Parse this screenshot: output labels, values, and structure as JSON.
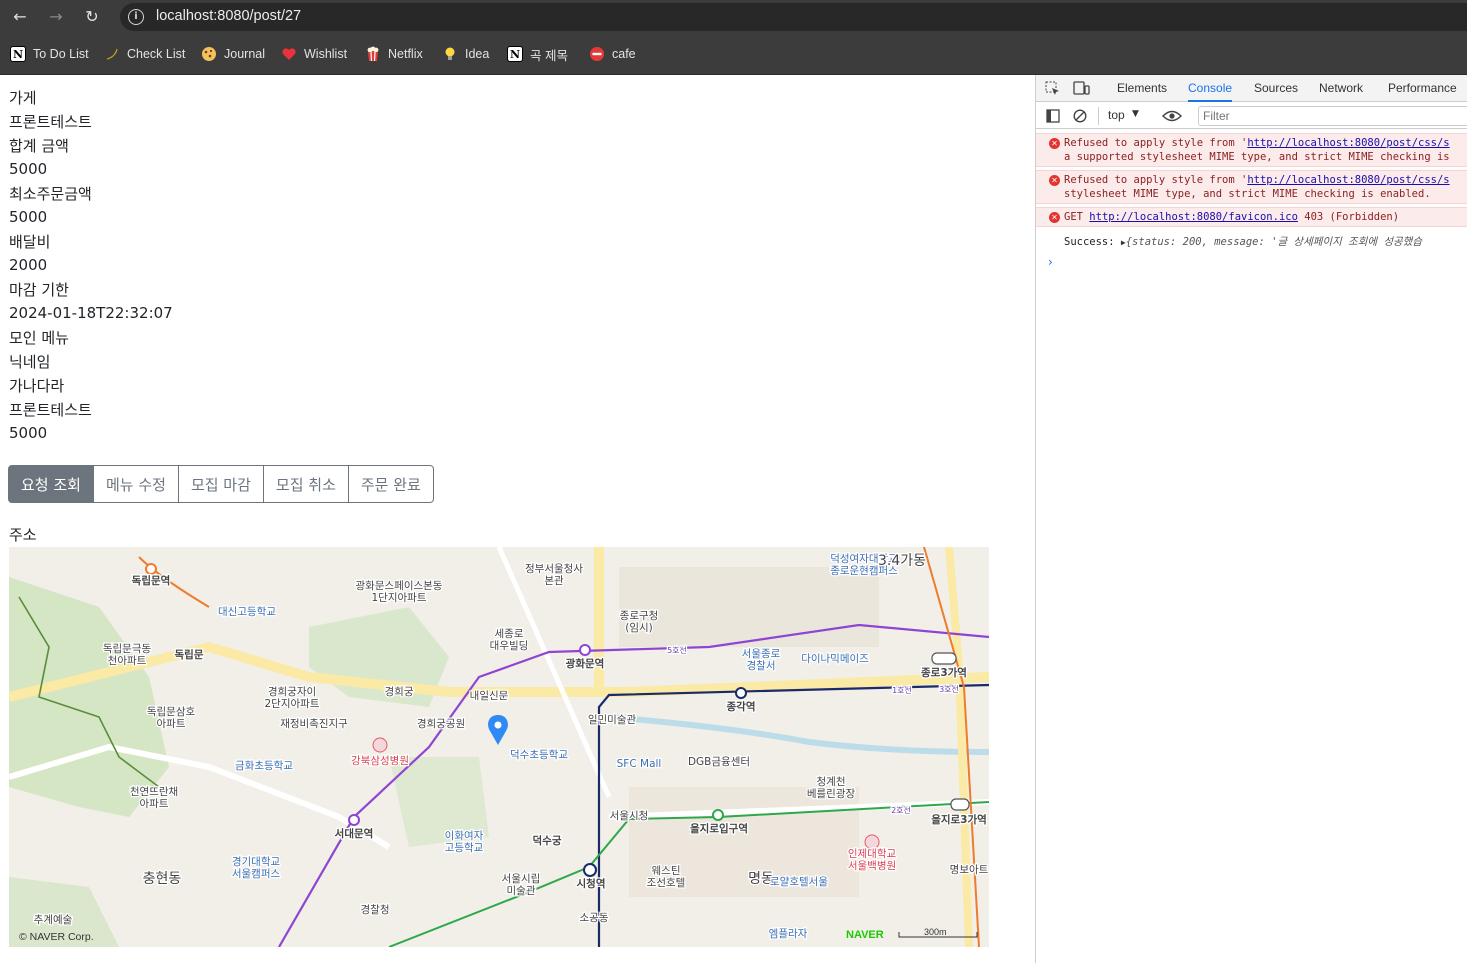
{
  "browser": {
    "url": "localhost:8080/post/27",
    "bookmarks": [
      {
        "label": "To Do List",
        "icon": "notion-icon"
      },
      {
        "label": "Check List",
        "icon": "banana-icon"
      },
      {
        "label": "Journal",
        "icon": "cookie-icon"
      },
      {
        "label": "Wishlist",
        "icon": "heart-icon"
      },
      {
        "label": "Netflix",
        "icon": "popcorn-icon"
      },
      {
        "label": "Idea",
        "icon": "lightbulb-icon"
      },
      {
        "label": "곡 제목",
        "icon": "notion-icon"
      },
      {
        "label": "cafe",
        "icon": "no-entry-icon"
      }
    ]
  },
  "post": {
    "lines": [
      "가게",
      "프론트테스트",
      "합계 금액",
      "5000",
      "최소주문금액",
      "5000",
      "배달비",
      "2000",
      "마감 기한",
      "2024-01-18T22:32:07",
      "모인 메뉴",
      "닉네임",
      "가나다라",
      "프론트테스트",
      "5000"
    ],
    "buttons": [
      "요청 조회",
      "메뉴 수정",
      "모집 마감",
      "모집 취소",
      "주문 완료"
    ],
    "address_label": "주소"
  },
  "map": {
    "labels": [
      "독립문역",
      "대신고등학교",
      "독립문극동\n천아파트",
      "독립문",
      "독립문삼호\n아파트",
      "천연뜨란채\n아파트",
      "광화문스페이스본동\n1단지아파트",
      "정부서울청사\n본관",
      "종로구청\n(임시)",
      "세종로\n대우빌딩",
      "광화문역",
      "경희궁자이\n2단지아파트",
      "경희궁",
      "내일신문",
      "재정비촉진지구",
      "경희궁공원",
      "강북삼성병원",
      "금화초등학교",
      "덕수초등학교",
      "서대문역",
      "이화여자\n고등학교",
      "덕수궁",
      "경기대학교\n서울캠퍼스",
      "충현동",
      "서울시립\n미술관",
      "시청역",
      "경찰청",
      "추계예술",
      "일민미술관",
      "SFC Mall",
      "DGB금융센터",
      "서울시청",
      "을지로입구역",
      "웨스틴\n조선호텔",
      "서울종로\n경찰서",
      "다이나믹메이즈",
      "덕성여자대학교\n종로운현캠퍼스",
      "3.4가동",
      "종로3가역",
      "종각역",
      "청계천\n베를린광장",
      "을지로3가역",
      "인제대학교\n서울백병원",
      "명동",
      "로얄호텔서울",
      "엠플라자",
      "명보아트",
      "소공동",
      "5호선",
      "1호선",
      "2호선",
      "3호선"
    ],
    "copyright": "© NAVER Corp.",
    "brand": "NAVER",
    "scale": "300m"
  },
  "devtools": {
    "tabs": [
      "Elements",
      "Console",
      "Sources",
      "Network",
      "Performance"
    ],
    "active_tab": "Console",
    "context": "top",
    "filter_placeholder": "Filter",
    "messages": [
      {
        "type": "error",
        "pre": "Refused to apply style from '",
        "link": "http://localhost:8080/post/css/s",
        "line2": "a supported stylesheet MIME type, and strict MIME checking is"
      },
      {
        "type": "error",
        "pre": "Refused to apply style from '",
        "link": "http://localhost:8080/post/css/s",
        "line2": "stylesheet MIME type, and strict MIME checking is enabled."
      },
      {
        "type": "error",
        "pre": "GET ",
        "link": "http://localhost:8080/favicon.ico",
        "post": " 403 (Forbidden)"
      },
      {
        "type": "log",
        "pre": "Success: ",
        "obj": "{status: 200, message: '글 상세페이지 조회에 성공했습"
      }
    ]
  }
}
